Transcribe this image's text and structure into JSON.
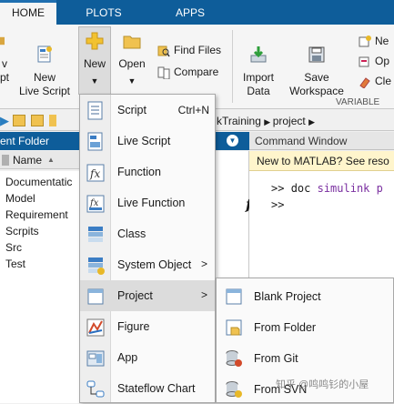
{
  "tabs": [
    {
      "label": "HOME",
      "active": true
    },
    {
      "label": "PLOTS",
      "active": false
    },
    {
      "label": "APPS",
      "active": false
    }
  ],
  "ribbon": {
    "partial_left_label_1": "v",
    "partial_left_label_2": "pt",
    "new_live_script": "New\nLive Script",
    "new": "New",
    "open": "Open",
    "find_files": "Find Files",
    "compare": "Compare",
    "import_data": "Import\nData",
    "save_workspace": "Save\nWorkspace",
    "new_variable_partial": "Ne",
    "open_variable_partial": "Op",
    "clear_workspace_partial": "Cle",
    "variable_group_label": "VARIABLE"
  },
  "address": {
    "path_tail": "kTraining",
    "path_last": "project"
  },
  "current_folder": {
    "title": "ent Folder",
    "column_header": "Name",
    "sort_indicator": "▲",
    "items": [
      "Documentatic",
      "Model",
      "Requirement",
      "Scrpits",
      "Src",
      "Test"
    ]
  },
  "command_window": {
    "title": "Command Window",
    "banner": "New to MATLAB? See reso",
    "line1_prompt": ">>",
    "line1_cmd": "doc",
    "line1_arg": "simulink p",
    "line2_prompt": ">>",
    "fx_label": "fx"
  },
  "new_menu": {
    "items": [
      {
        "label": "Script",
        "shortcut": "Ctrl+N",
        "icon": "script-icon",
        "submenu": false
      },
      {
        "label": "Live Script",
        "shortcut": "",
        "icon": "live-script-icon",
        "submenu": false
      },
      {
        "label": "Function",
        "shortcut": "",
        "icon": "function-icon",
        "submenu": false
      },
      {
        "label": "Live Function",
        "shortcut": "",
        "icon": "live-function-icon",
        "submenu": false
      },
      {
        "label": "Class",
        "shortcut": "",
        "icon": "class-icon",
        "submenu": false
      },
      {
        "label": "System Object",
        "shortcut": "",
        "icon": "system-object-icon",
        "submenu": true
      },
      {
        "label": "Project",
        "shortcut": "",
        "icon": "project-icon",
        "submenu": true,
        "highlighted": true
      },
      {
        "label": "Figure",
        "shortcut": "",
        "icon": "figure-icon",
        "submenu": false
      },
      {
        "label": "App",
        "shortcut": "",
        "icon": "app-icon",
        "submenu": false
      },
      {
        "label": "Stateflow Chart",
        "shortcut": "",
        "icon": "stateflow-icon",
        "submenu": false
      }
    ]
  },
  "project_submenu": {
    "items": [
      {
        "label": "Blank Project",
        "icon": "blank-project-icon"
      },
      {
        "label": "From Folder",
        "icon": "from-folder-icon"
      },
      {
        "label": "From Git",
        "icon": "from-git-icon"
      },
      {
        "label": "From SVN",
        "icon": "from-svn-icon"
      }
    ]
  },
  "watermark": "知乎 @鸣鸣钐的小屋",
  "colors": {
    "tab_bar": "#0e5d9a",
    "panel_header": "#0e5d9a",
    "banner": "#fff5cc",
    "highlight": "#dcdcdc"
  }
}
